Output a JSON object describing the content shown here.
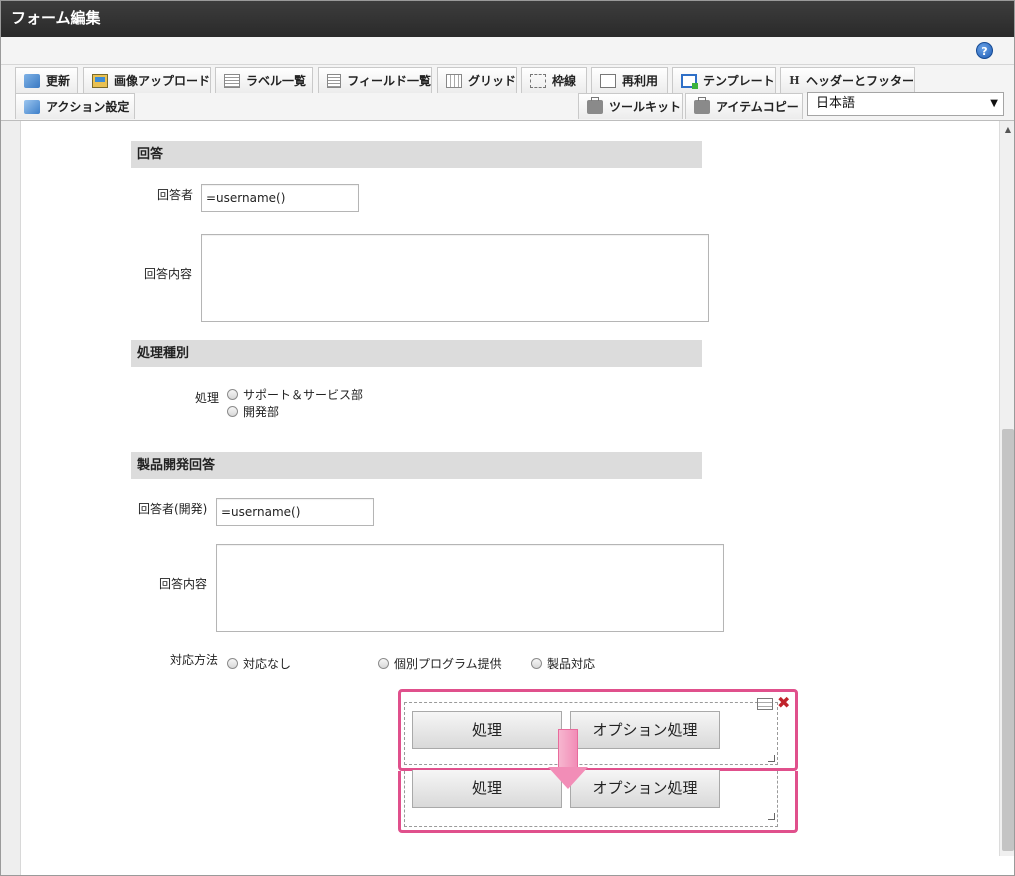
{
  "window": {
    "title": "フォーム編集"
  },
  "help": {
    "icon": "question-circle-icon",
    "glyph": "?"
  },
  "toolbar": {
    "row1": [
      {
        "id": "update",
        "label": "更新",
        "icon": "update-icon"
      },
      {
        "id": "image-upload",
        "label": "画像アップロード",
        "icon": "image-icon"
      },
      {
        "id": "label-list",
        "label": "ラベル一覧",
        "icon": "list-icon"
      },
      {
        "id": "field-list",
        "label": "フィールド一覧",
        "icon": "list-icon"
      },
      {
        "id": "grid",
        "label": "グリッド",
        "icon": "grid-icon"
      },
      {
        "id": "frame",
        "label": "枠線",
        "icon": "frame-icon"
      },
      {
        "id": "reuse",
        "label": "再利用",
        "icon": "document-icon"
      },
      {
        "id": "template",
        "label": "テンプレート",
        "icon": "template-icon"
      },
      {
        "id": "header-footer",
        "label": "ヘッダーとフッター",
        "icon": "header-icon"
      }
    ],
    "row2": [
      {
        "id": "action-settings",
        "label": "アクション設定",
        "icon": "action-icon"
      },
      {
        "id": "toolkit",
        "label": "ツールキット",
        "icon": "toolbox-icon"
      },
      {
        "id": "item-copy",
        "label": "アイテムコピー",
        "icon": "toolbox-icon"
      }
    ],
    "language": {
      "selected": "日本語",
      "arrow": "▼"
    },
    "header_glyph": "H"
  },
  "form": {
    "section_answer": {
      "title": "回答",
      "responder_label": "回答者",
      "responder_value": "=username()",
      "content_label": "回答内容"
    },
    "section_type": {
      "title": "処理種別",
      "label": "処理",
      "options": [
        "サポート＆サービス部",
        "開発部"
      ]
    },
    "section_product": {
      "title": "製品開発回答",
      "responder_label": "回答者(開発)",
      "responder_value": "=username()",
      "content_label": "回答内容",
      "method_label": "対応方法",
      "method_options": [
        "対応なし",
        "個別プログラム提供",
        "製品対応"
      ]
    },
    "buttons": {
      "process": "処理",
      "option_process": "オプション処理"
    }
  },
  "colors": {
    "highlight": "#e0508c",
    "arrow": "#f28db7",
    "section_bg": "#dcdcdc",
    "titlebar": "#333333"
  },
  "scrollbar": {
    "up_glyph": "▲"
  },
  "close_glyph": "✖"
}
